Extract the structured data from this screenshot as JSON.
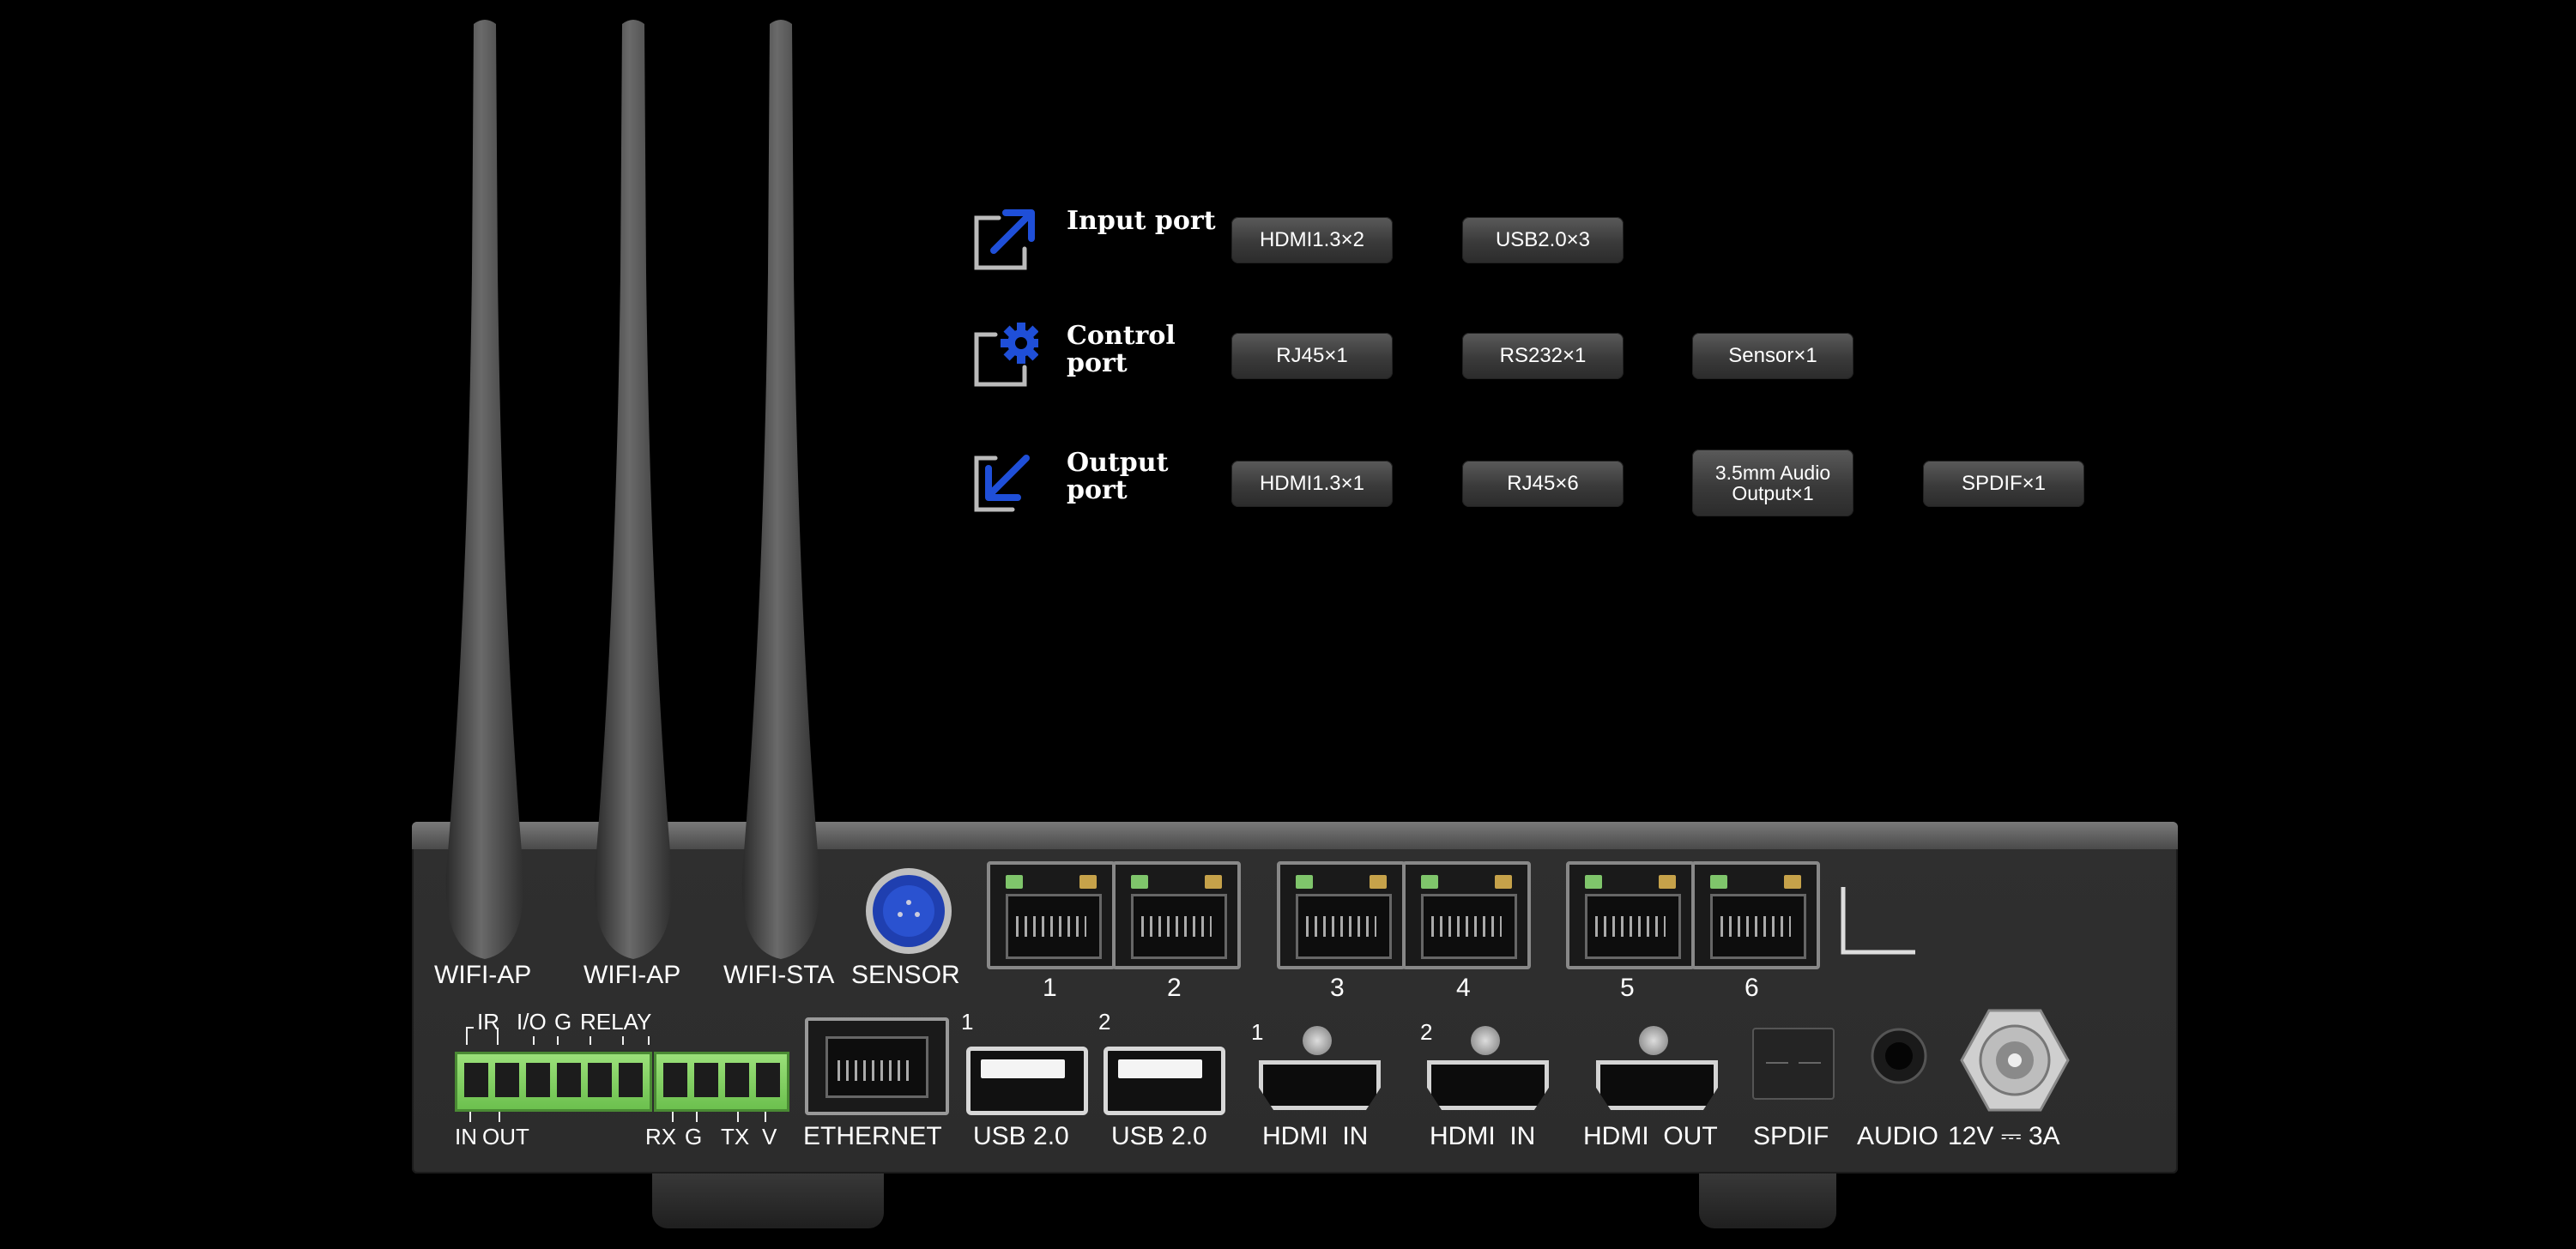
{
  "legend": {
    "categories": [
      {
        "label": "Input port",
        "icon": "arrow-up-right-icon",
        "items": [
          "HDMI1.3×2",
          "USB2.0×3"
        ]
      },
      {
        "label": "Control\nport",
        "icon": "gear-icon",
        "items": [
          "RJ45×1",
          "RS232×1",
          "Sensor×1"
        ]
      },
      {
        "label": "Output\nport",
        "icon": "arrow-down-left-icon",
        "items": [
          "HDMI1.3×1",
          "RJ45×6",
          "3.5mm Audio\nOutput×1",
          "SPDIF×1"
        ]
      }
    ],
    "accent_color": "#1f4fd8"
  },
  "device": {
    "top_row": {
      "antennas": [
        "WIFI-AP",
        "WIFI-AP",
        "WIFI-STA"
      ],
      "sensor": "SENSOR",
      "rj45_numbers": [
        "1",
        "2",
        "3",
        "4",
        "5",
        "6"
      ]
    },
    "bottom_row": {
      "terminal_top": [
        "IR",
        "I/O",
        "G",
        "RELAY"
      ],
      "terminal_bottom": [
        "IN",
        "OUT",
        "RX",
        "G",
        "TX",
        "V"
      ],
      "ethernet": "ETHERNET",
      "usb_numbers": [
        "1",
        "2"
      ],
      "usb_labels": [
        "USB 2.0",
        "USB 2.0"
      ],
      "hdmi_numbers": [
        "1",
        "2"
      ],
      "hdmi_labels": [
        "HDMI  IN",
        "HDMI  IN",
        "HDMI  OUT"
      ],
      "spdif": "SPDIF",
      "audio": "AUDIO",
      "power": "12V ⎓ 3A"
    }
  }
}
